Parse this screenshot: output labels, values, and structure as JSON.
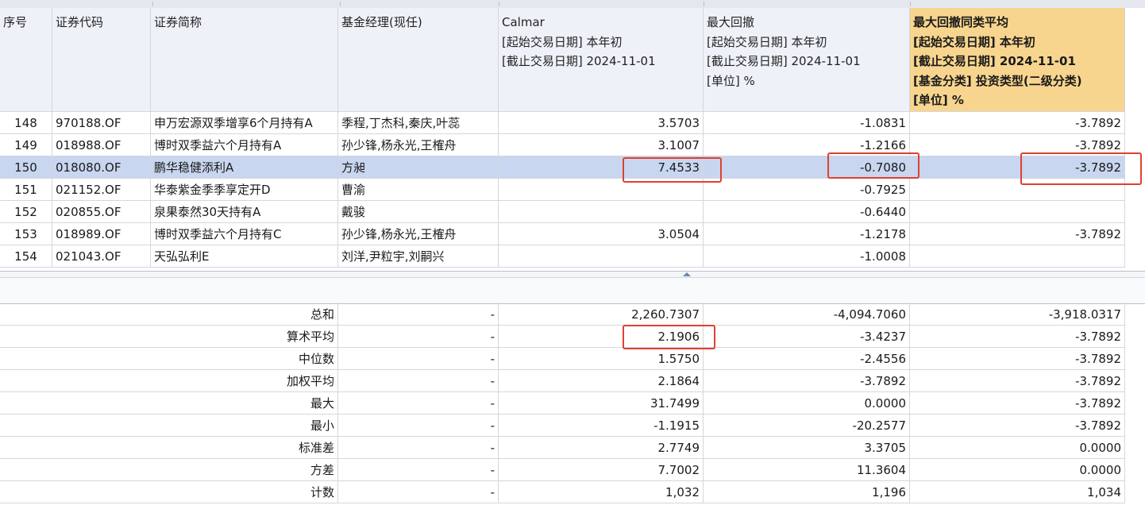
{
  "columns": {
    "seq": "序号",
    "code": "证券代码",
    "name": "证券简称",
    "manager": "基金经理(现任)",
    "calmar": [
      "Calmar",
      "[起始交易日期] 本年初",
      "[截止交易日期] 2024-11-01"
    ],
    "maxdd": [
      "最大回撤",
      "[起始交易日期] 本年初",
      "[截止交易日期] 2024-11-01",
      "[单位] %"
    ],
    "maxdd_avg": [
      "最大回撤同类平均",
      "[起始交易日期] 本年初",
      "[截止交易日期] 2024-11-01",
      "[基金分类] 投资类型(二级分类)",
      "[单位] %"
    ]
  },
  "rows": [
    {
      "seq": "148",
      "code": "970188.OF",
      "name": "申万宏源双季增享6个月持有A",
      "manager": "季程,丁杰科,秦庆,叶蕊",
      "calmar": "3.5703",
      "maxdd": "-1.0831",
      "maxdd_avg": "-3.7892"
    },
    {
      "seq": "149",
      "code": "018988.OF",
      "name": "博时双季益六个月持有A",
      "manager": "孙少锋,杨永光,王榷舟",
      "calmar": "3.1007",
      "maxdd": "-1.2166",
      "maxdd_avg": "-3.7892"
    },
    {
      "seq": "150",
      "code": "018080.OF",
      "name": "鹏华稳健添利A",
      "manager": "方昶",
      "calmar": "7.4533",
      "maxdd": "-0.7080",
      "maxdd_avg": "-3.7892",
      "selected": true
    },
    {
      "seq": "151",
      "code": "021152.OF",
      "name": "华泰紫金季季享定开D",
      "manager": "曹渝",
      "calmar": "",
      "maxdd": "-0.7925",
      "maxdd_avg": ""
    },
    {
      "seq": "152",
      "code": "020855.OF",
      "name": "泉果泰然30天持有A",
      "manager": "戴骏",
      "calmar": "",
      "maxdd": "-0.6440",
      "maxdd_avg": ""
    },
    {
      "seq": "153",
      "code": "018989.OF",
      "name": "博时双季益六个月持有C",
      "manager": "孙少锋,杨永光,王榷舟",
      "calmar": "3.0504",
      "maxdd": "-1.2178",
      "maxdd_avg": "-3.7892"
    },
    {
      "seq": "154",
      "code": "021043.OF",
      "name": "天弘弘利E",
      "manager": "刘洋,尹粒宇,刘嗣兴",
      "calmar": "",
      "maxdd": "-1.0008",
      "maxdd_avg": ""
    }
  ],
  "summary": [
    {
      "label": "总和",
      "manager": "-",
      "calmar": "2,260.7307",
      "maxdd": "-4,094.7060",
      "maxdd_avg": "-3,918.0317"
    },
    {
      "label": "算术平均",
      "manager": "-",
      "calmar": "2.1906",
      "maxdd": "-3.4237",
      "maxdd_avg": "-3.7892"
    },
    {
      "label": "中位数",
      "manager": "-",
      "calmar": "1.5750",
      "maxdd": "-2.4556",
      "maxdd_avg": "-3.7892"
    },
    {
      "label": "加权平均",
      "manager": "-",
      "calmar": "2.1864",
      "maxdd": "-3.7892",
      "maxdd_avg": "-3.7892"
    },
    {
      "label": "最大",
      "manager": "-",
      "calmar": "31.7499",
      "maxdd": "0.0000",
      "maxdd_avg": "-3.7892"
    },
    {
      "label": "最小",
      "manager": "-",
      "calmar": "-1.1915",
      "maxdd": "-20.2577",
      "maxdd_avg": "-3.7892"
    },
    {
      "label": "标准差",
      "manager": "-",
      "calmar": "2.7749",
      "maxdd": "3.3705",
      "maxdd_avg": "0.0000"
    },
    {
      "label": "方差",
      "manager": "-",
      "calmar": "7.7002",
      "maxdd": "11.3604",
      "maxdd_avg": "0.0000"
    },
    {
      "label": "计数",
      "manager": "-",
      "calmar": "1,032",
      "maxdd": "1,196",
      "maxdd_avg": "1,034"
    }
  ],
  "colors": {
    "header_bg": "#eef2f8",
    "highlight_header_bg": "#f7d58e",
    "selected_row_bg": "#c8d6ef",
    "annotation_red": "#e0402f"
  }
}
